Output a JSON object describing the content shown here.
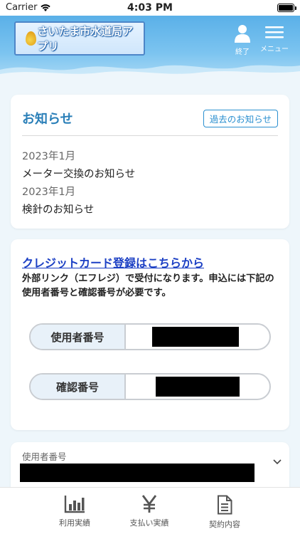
{
  "status_bar": {
    "carrier": "Carrier",
    "time": "4:03 PM"
  },
  "header": {
    "logo_text": "さいたま市水道局アプリ",
    "end_label": "終了",
    "menu_label": "メニュー"
  },
  "news": {
    "title": "お知らせ",
    "past_button": "過去のお知らせ",
    "items": [
      {
        "date": "2023年1月",
        "title": "メーター交換のお知らせ"
      },
      {
        "date": "2023年1月",
        "title": "検針のお知らせ"
      }
    ]
  },
  "credit": {
    "link": "クレジットカード登録はこちらから",
    "description": "外部リンク（エフレジ）で受付になります。申込には下記の使用者番号と確認番号が必要です。",
    "user_number_label": "使用者番号",
    "confirm_number_label": "確認番号"
  },
  "user_select": {
    "label": "使用者番号"
  },
  "tabs": [
    {
      "label": "利用実績",
      "icon": "bar-chart-icon"
    },
    {
      "label": "支払い実績",
      "icon": "yen-icon"
    },
    {
      "label": "契約内容",
      "icon": "document-icon"
    }
  ],
  "colors": {
    "accent": "#2a7fb8",
    "link": "#1b3fc4",
    "header": "#5ab0e8"
  }
}
